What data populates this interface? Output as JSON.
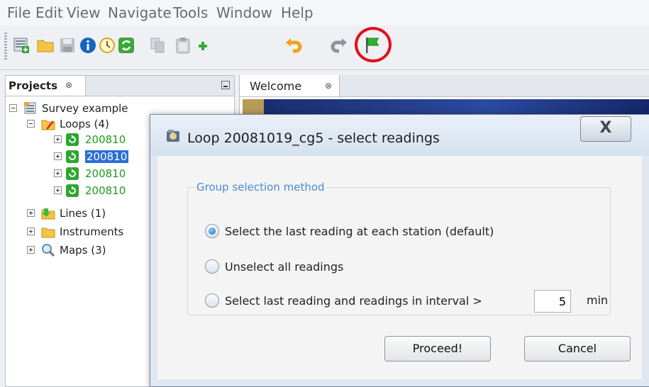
{
  "menu": [
    "File",
    "Edit",
    "View",
    "Navigate",
    "Tools",
    "Window",
    "Help"
  ],
  "toolbar": {
    "icons": [
      "new-project-icon",
      "open-folder-icon",
      "save-icon",
      "info-icon",
      "clock-icon",
      "refresh-icon",
      "copy-icon",
      "paste-icon",
      "add-icon",
      "undo-icon",
      "redo-icon",
      "green-flag-icon"
    ]
  },
  "projects_panel": {
    "tab_label": "Projects",
    "close_glyph": "⊗",
    "tree": {
      "root": "Survey example",
      "loops": "Loops (4)",
      "loop_items": [
        "200810",
        "200810",
        "200810",
        "200810"
      ],
      "lines": "Lines (1)",
      "instruments": "Instruments",
      "maps": "Maps (3)"
    }
  },
  "welcome_tab": {
    "label": "Welcome",
    "close_glyph": "⊗"
  },
  "dialog": {
    "title": "Loop 20081019_cg5 - select readings",
    "close_glyph": "X",
    "group_title": "Group selection method",
    "options": [
      {
        "label": "Select the last reading at each station (default)",
        "selected": true
      },
      {
        "label": "Unselect all readings",
        "selected": false
      },
      {
        "label": "Select last reading and readings in interval >",
        "selected": false
      }
    ],
    "interval_value": "5",
    "interval_unit": "min",
    "proceed_label": "Proceed!",
    "cancel_label": "Cancel"
  },
  "colors": {
    "highlight_circle": "#e0101a",
    "selection": "#2b6fd6",
    "loop_text": "#1c9e1c"
  }
}
